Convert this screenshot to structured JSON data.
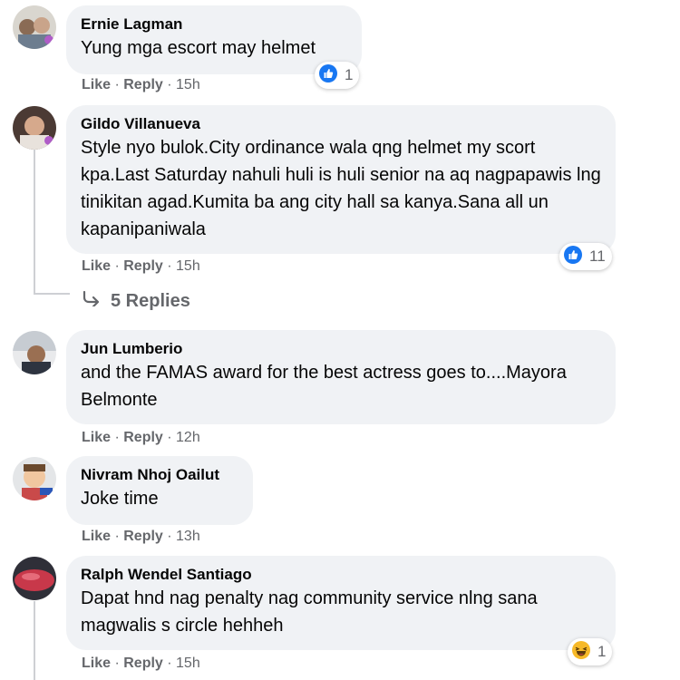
{
  "comments": [
    {
      "author": "Ernie Lagman",
      "text": "Yung mga escort may helmet",
      "like": "Like",
      "reply": "Reply",
      "time": "15h",
      "reaction": {
        "icon": "like-icon",
        "count": "1"
      }
    },
    {
      "author": "Gildo Villanueva",
      "text": "Style nyo bulok.City ordinance wala qng helmet my scort kpa.Last Saturday nahuli huli is huli senior na aq nagpapawis lng tinikitan agad.Kumita ba ang city hall sa kanya.Sana all un kapanipaniwala",
      "like": "Like",
      "reply": "Reply",
      "time": "15h",
      "reaction": {
        "icon": "like-icon",
        "count": "11"
      },
      "replies_label": "5 Replies"
    },
    {
      "author": "Jun Lumberio",
      "text": "and the FAMAS award for the best actress goes to....Mayora Belmonte",
      "like": "Like",
      "reply": "Reply",
      "time": "12h"
    },
    {
      "author": "Nivram Nhoj Oailut",
      "text": "Joke time",
      "like": "Like",
      "reply": "Reply",
      "time": "13h"
    },
    {
      "author": "Ralph Wendel Santiago",
      "text": "Dapat hnd nag penalty nag community service nlng sana magwalis s circle hehheh",
      "like": "Like",
      "reply": "Reply",
      "time": "15h",
      "reaction": {
        "icon": "haha-icon",
        "count": "1"
      }
    }
  ],
  "colors": {
    "bubble": "#f0f2f5",
    "muted": "#65676b",
    "like_blue": "#1877f2",
    "haha_yellow": "#f7b928"
  }
}
